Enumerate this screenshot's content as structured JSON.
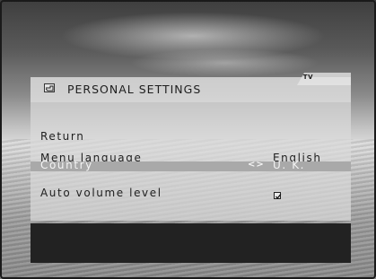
{
  "osd": {
    "source_tag": "TV",
    "title": "PERSONAL SETTINGS",
    "title_icon": "hand-pointer-icon",
    "menu": {
      "return_label": "Return",
      "menu_language_label": "Menu language",
      "menu_language_value": "English",
      "country_label": "Country",
      "country_arrows": "<>",
      "country_value": "U. K.",
      "auto_volume_label": "Auto volume level",
      "auto_volume_checked": true
    }
  },
  "colors": {
    "highlight": "#a9a9a9",
    "panel": "#dadada",
    "footer": "#222222",
    "text": "#1e1e1e"
  }
}
